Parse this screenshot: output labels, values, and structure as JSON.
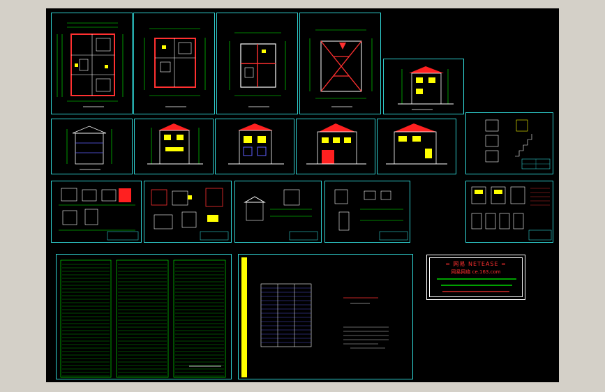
{
  "colors": {
    "background": "#000000",
    "window_bg": "#d4d0c8",
    "sheet_border": "#2fd0d0",
    "wall": "#ff3030",
    "dim": "#00ff00",
    "line": "#ffffff",
    "yellow": "#ffff00",
    "roof": "#ff2020",
    "table_green": "#00ff00",
    "blue": "#6060ff",
    "stamp_text": "#ff3030"
  },
  "stamp": {
    "brand": "= 网易 NETEASE =",
    "site_line": "网易网络 ce.163.com"
  }
}
